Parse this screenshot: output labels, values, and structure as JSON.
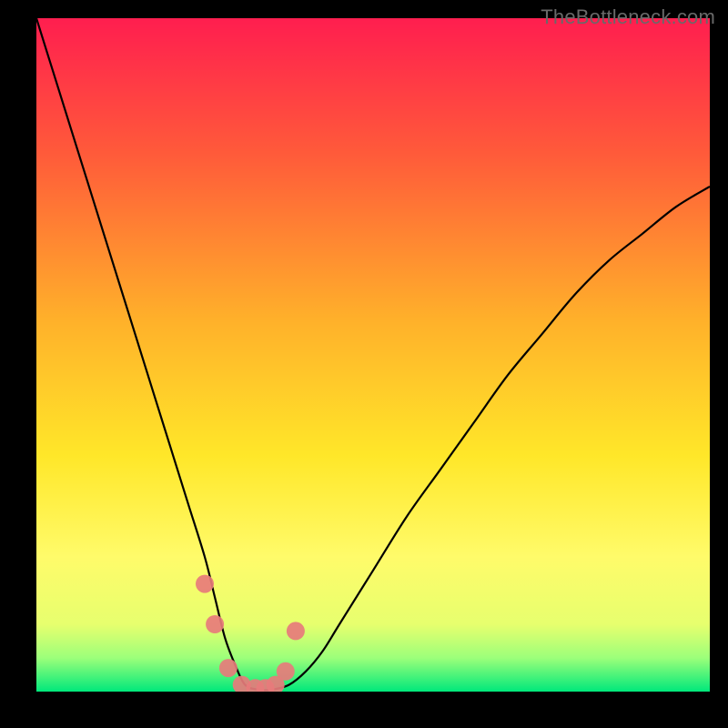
{
  "watermark": "TheBottleneck.com",
  "chart_data": {
    "type": "line",
    "title": "",
    "xlabel": "",
    "ylabel": "",
    "xlim": [
      0,
      100
    ],
    "ylim": [
      0,
      100
    ],
    "background_gradient": {
      "stops": [
        {
          "offset": 0.0,
          "color": "#ff1e4f"
        },
        {
          "offset": 0.2,
          "color": "#ff5a3a"
        },
        {
          "offset": 0.45,
          "color": "#ffb12a"
        },
        {
          "offset": 0.65,
          "color": "#ffe729"
        },
        {
          "offset": 0.8,
          "color": "#fffb6a"
        },
        {
          "offset": 0.9,
          "color": "#e7ff6e"
        },
        {
          "offset": 0.95,
          "color": "#9cff7a"
        },
        {
          "offset": 1.0,
          "color": "#00e87b"
        }
      ]
    },
    "series": [
      {
        "name": "bottleneck-curve",
        "color": "#000000",
        "x": [
          0,
          2.5,
          5,
          7.5,
          10,
          12.5,
          15,
          17.5,
          20,
          22.5,
          25,
          26.5,
          28,
          29.5,
          31,
          33,
          35,
          37.5,
          40,
          42.5,
          45,
          50,
          55,
          60,
          65,
          70,
          75,
          80,
          85,
          90,
          95,
          100
        ],
        "y": [
          100,
          92,
          84,
          76,
          68,
          60,
          52,
          44,
          36,
          28,
          20,
          14,
          8,
          4,
          1,
          0.3,
          0.3,
          1,
          3,
          6,
          10,
          18,
          26,
          33,
          40,
          47,
          53,
          59,
          64,
          68,
          72,
          75
        ]
      },
      {
        "name": "marker-dots",
        "type": "scatter",
        "color": "#e77b7b",
        "x": [
          25,
          26.5,
          28.5,
          30.5,
          32.5,
          34,
          35.5,
          37,
          38.5
        ],
        "y": [
          16,
          10,
          3.5,
          1,
          0.5,
          0.5,
          1,
          3,
          9
        ]
      }
    ]
  }
}
